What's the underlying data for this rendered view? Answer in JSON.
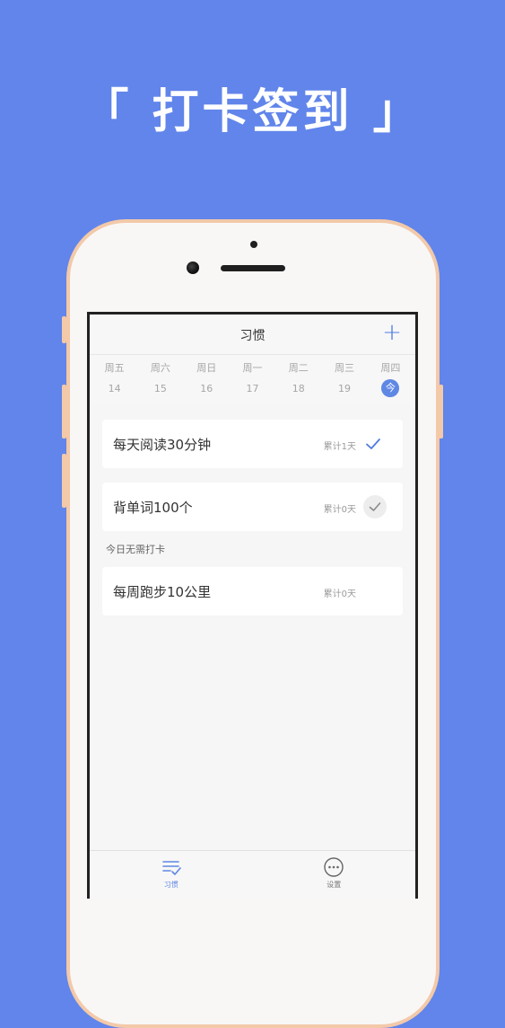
{
  "promo": {
    "title": "「 打卡签到 」"
  },
  "app": {
    "nav": {
      "title": "习惯",
      "add_label": "+"
    },
    "week": [
      {
        "name": "周五",
        "num": "14",
        "today": false
      },
      {
        "name": "周六",
        "num": "15",
        "today": false
      },
      {
        "name": "周日",
        "num": "16",
        "today": false
      },
      {
        "name": "周一",
        "num": "17",
        "today": false
      },
      {
        "name": "周二",
        "num": "18",
        "today": false
      },
      {
        "name": "周三",
        "num": "19",
        "today": false
      },
      {
        "name": "周四",
        "num": "今",
        "today": true
      }
    ],
    "habits": [
      {
        "title": "每天阅读30分钟",
        "count": "累计1天",
        "status": "checked"
      },
      {
        "title": "背单词100个",
        "count": "累计0天",
        "status": "circle"
      }
    ],
    "section_label": "今日无需打卡",
    "rest_habits": [
      {
        "title": "每周跑步10公里",
        "count": "累计0天"
      }
    ],
    "tabs": [
      {
        "label": "习惯",
        "active": true,
        "icon": "list-check-icon"
      },
      {
        "label": "设置",
        "active": false,
        "icon": "more-circle-icon"
      }
    ]
  },
  "colors": {
    "background": "#6185ea",
    "accent": "#5f87e4",
    "phone_frame": "#f3c9a9"
  }
}
